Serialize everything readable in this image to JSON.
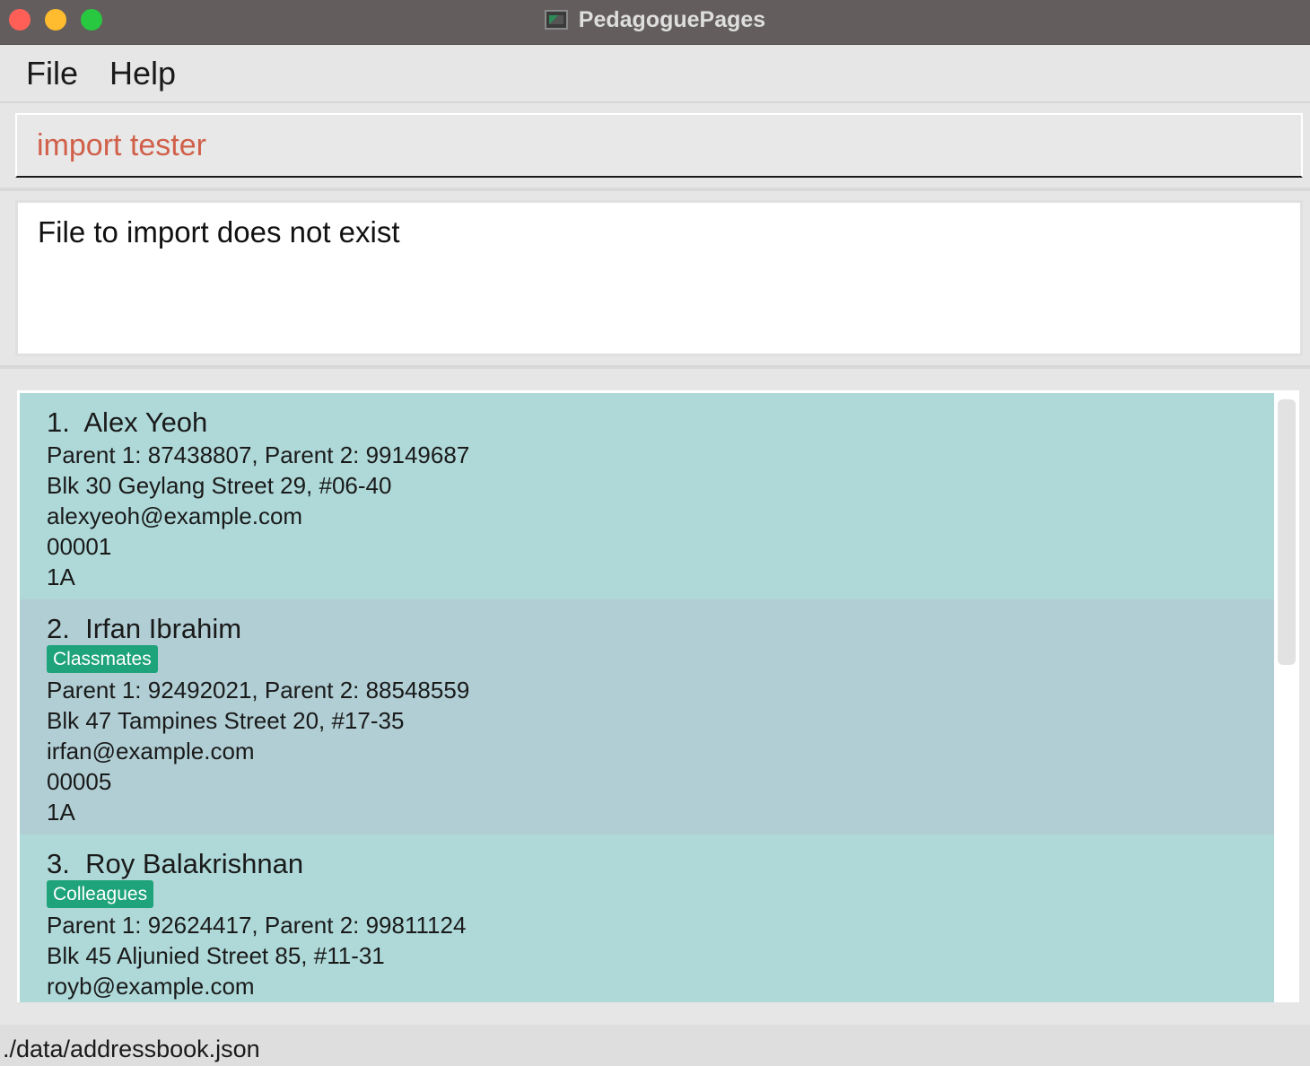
{
  "window": {
    "title": "PedagoguePages"
  },
  "menu": {
    "file": "File",
    "help": "Help"
  },
  "command": {
    "value": "import tester"
  },
  "result": {
    "message": "File to import does not exist"
  },
  "persons": [
    {
      "index": "1.",
      "name": "Alex Yeoh",
      "tag": "",
      "phones": "Parent 1: 87438807, Parent 2: 99149687",
      "address": "Blk 30 Geylang Street 29, #06-40",
      "email": "alexyeoh@example.com",
      "id": "00001",
      "class": "1A"
    },
    {
      "index": "2.",
      "name": "Irfan Ibrahim",
      "tag": "Classmates",
      "phones": "Parent 1: 92492021, Parent 2: 88548559",
      "address": "Blk 47 Tampines Street 20, #17-35",
      "email": "irfan@example.com",
      "id": "00005",
      "class": "1A"
    },
    {
      "index": "3.",
      "name": "Roy Balakrishnan",
      "tag": "Colleagues",
      "phones": "Parent 1: 92624417, Parent 2: 99811124",
      "address": "Blk 45 Aljunied Street 85, #11-31",
      "email": "royb@example.com"
    }
  ],
  "status": {
    "path": "./data/addressbook.json"
  },
  "colors": {
    "card_even": "#afd9d9",
    "card_odd": "#b0ced4",
    "tag": "#1fa37a",
    "command_text": "#d0604a",
    "titlebar": "#635e5d"
  }
}
